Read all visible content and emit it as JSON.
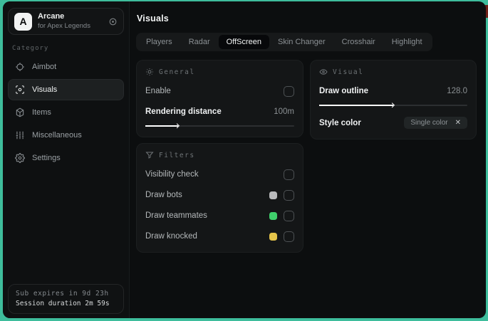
{
  "sidebar": {
    "brand": {
      "logo_letter": "A",
      "title": "Arcane",
      "subtitle": "for Apex Legends"
    },
    "category_label": "Category",
    "items": [
      {
        "label": "Aimbot",
        "icon": "crosshair-icon",
        "selected": false
      },
      {
        "label": "Visuals",
        "icon": "scan-eye-icon",
        "selected": true
      },
      {
        "label": "Items",
        "icon": "package-icon",
        "selected": false
      },
      {
        "label": "Miscellaneous",
        "icon": "sliders-icon",
        "selected": false
      },
      {
        "label": "Settings",
        "icon": "gear-icon",
        "selected": false
      }
    ],
    "footer": {
      "line1": "Sub expires in 9d 23h",
      "line2": "Session duration 2m 59s"
    }
  },
  "main": {
    "title": "Visuals",
    "tabs": [
      {
        "label": "Players",
        "selected": false
      },
      {
        "label": "Radar",
        "selected": false
      },
      {
        "label": "OffScreen",
        "selected": true
      },
      {
        "label": "Skin Changer",
        "selected": false
      },
      {
        "label": "Crosshair",
        "selected": false
      },
      {
        "label": "Highlight",
        "selected": false
      }
    ],
    "general": {
      "title": "General",
      "enable_label": "Enable",
      "enable_checked": false,
      "rendering_label": "Rendering distance",
      "rendering_value": "100m",
      "slider_fill": "22%"
    },
    "filters": {
      "title": "Filters",
      "rows": [
        {
          "label": "Visibility check",
          "swatch": "",
          "checked": false
        },
        {
          "label": "Draw bots",
          "swatch": "#b9babc",
          "checked": false
        },
        {
          "label": "Draw teammates",
          "swatch": "#3fd06c",
          "checked": false
        },
        {
          "label": "Draw knocked",
          "swatch": "#e5c44a",
          "checked": false
        }
      ]
    },
    "visual": {
      "title": "Visual",
      "outline_label": "Draw outline",
      "outline_value": "128.0",
      "slider_fill": "50%",
      "style_label": "Style color",
      "style_value": "Single color",
      "clear_glyph": "✕"
    }
  },
  "colors": {
    "desktop": "#3ebd9c",
    "window_bg": "#0c0e0f",
    "panel_bg": "#141617",
    "bots_swatch": "#b9babc",
    "teammates_swatch": "#3fd06c",
    "knocked_swatch": "#e5c44a"
  }
}
